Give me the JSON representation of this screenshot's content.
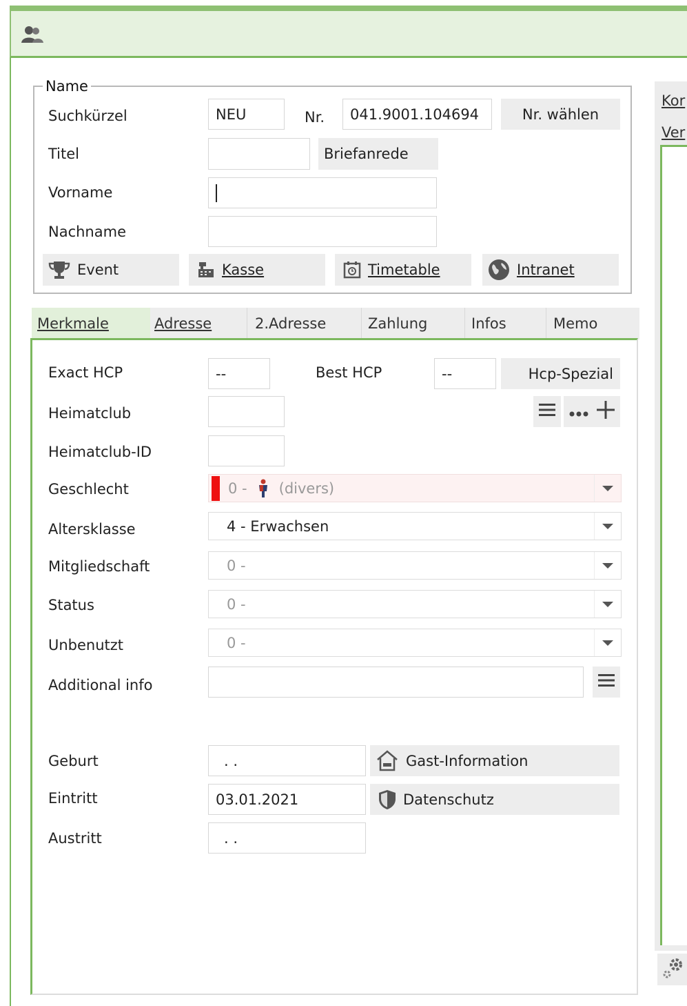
{
  "title_icon": "users-icon",
  "name_group": {
    "legend": "Name",
    "suchkuerzel": {
      "label": "Suchkürzel",
      "value": "NEU"
    },
    "nr": {
      "label": "Nr.",
      "value": "041.9001.104694",
      "button": "Nr. wählen"
    },
    "titel": {
      "label": "Titel",
      "value": "",
      "button": "Briefanrede"
    },
    "vorname": {
      "label": "Vorname",
      "value": ""
    },
    "nachname": {
      "label": "Nachname",
      "value": ""
    },
    "actions": [
      {
        "label": "Event",
        "icon": "trophy-icon"
      },
      {
        "label": "Kasse",
        "icon": "cash-register-icon"
      },
      {
        "label": "Timetable",
        "icon": "timer-icon"
      },
      {
        "label": "Intranet",
        "icon": "globe-icon"
      }
    ]
  },
  "tabs": [
    "Merkmale",
    "Adresse",
    "2.Adresse",
    "Zahlung",
    "Infos",
    "Memo"
  ],
  "active_tab": "Merkmale",
  "merkmale": {
    "exact_hcp": {
      "label": "Exact HCP",
      "value": "--"
    },
    "best_hcp": {
      "label": "Best HCP",
      "value": "--"
    },
    "hcp_button": "Hcp-Spezial",
    "heimatclub": {
      "label": "Heimatclub",
      "value": ""
    },
    "heimatclub_id": {
      "label": "Heimatclub-ID",
      "value": ""
    },
    "geschlecht": {
      "label": "Geschlecht",
      "prefix": "0 -",
      "value": "(divers)",
      "accent": "#ee1111"
    },
    "altersklasse": {
      "label": "Altersklasse",
      "value": "4 - Erwachsen"
    },
    "mitgliedschaft": {
      "label": "Mitgliedschaft",
      "value": "0 -"
    },
    "status": {
      "label": "Status",
      "value": "0 -"
    },
    "unbenutzt": {
      "label": "Unbenutzt",
      "value": "0 -"
    },
    "additional_info": {
      "label": "Additional info",
      "value": ""
    },
    "geburt": {
      "label": "Geburt",
      "value": ". ."
    },
    "eintritt": {
      "label": "Eintritt",
      "value": "03.01.2021"
    },
    "austritt": {
      "label": "Austritt",
      "value": ". ."
    },
    "gast_button": "Gast-Information",
    "datenschutz_button": "Datenschutz"
  },
  "right_panel": {
    "label1": "Kor",
    "label2": "Ver",
    "settings_icon": "gears-icon"
  },
  "colors": {
    "accent_green": "#7cb85e",
    "title_bg": "#e6f2df",
    "button_bg": "#ededed"
  }
}
